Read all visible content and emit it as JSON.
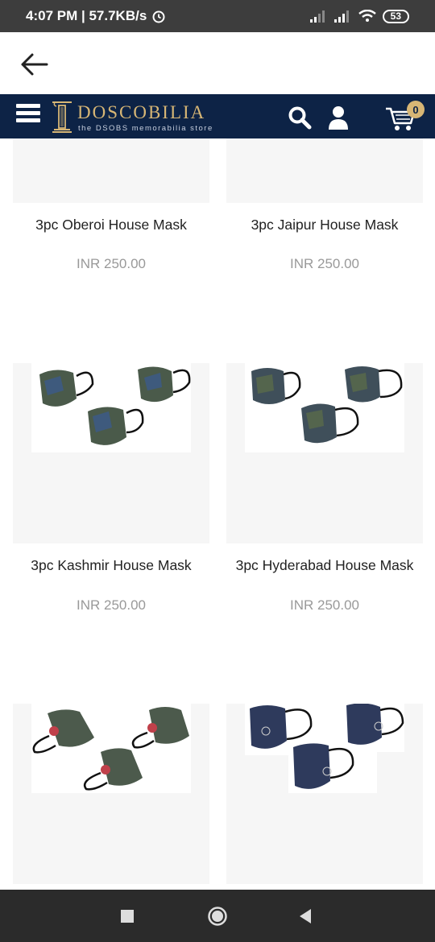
{
  "status_bar": {
    "time_speed": "4:07 PM | 57.7KB/s",
    "battery": "53"
  },
  "header": {
    "brand_name": "DOSCOBILIA",
    "brand_tagline": "the DSOBS memorabilia store",
    "cart_count": "0",
    "colors": {
      "background": "#0d2346",
      "accent": "#d7b675"
    }
  },
  "products": [
    {
      "title": "3pc Oberoi House Mask",
      "price": "INR 250.00"
    },
    {
      "title": "3pc Jaipur House Mask",
      "price": "INR 250.00"
    },
    {
      "title": "3pc Kashmir House Mask",
      "price": "INR 250.00"
    },
    {
      "title": "3pc Hyderabad House Mask",
      "price": "INR 250.00"
    },
    {
      "title": "",
      "price": ""
    },
    {
      "title": "",
      "price": ""
    }
  ],
  "icons": {
    "back": "back-arrow-icon",
    "menu": "hamburger-menu-icon",
    "search": "search-icon",
    "account": "user-icon",
    "cart": "shopping-cart-icon",
    "nav_recents": "square-icon",
    "nav_home": "circle-icon",
    "nav_back": "triangle-back-icon"
  }
}
